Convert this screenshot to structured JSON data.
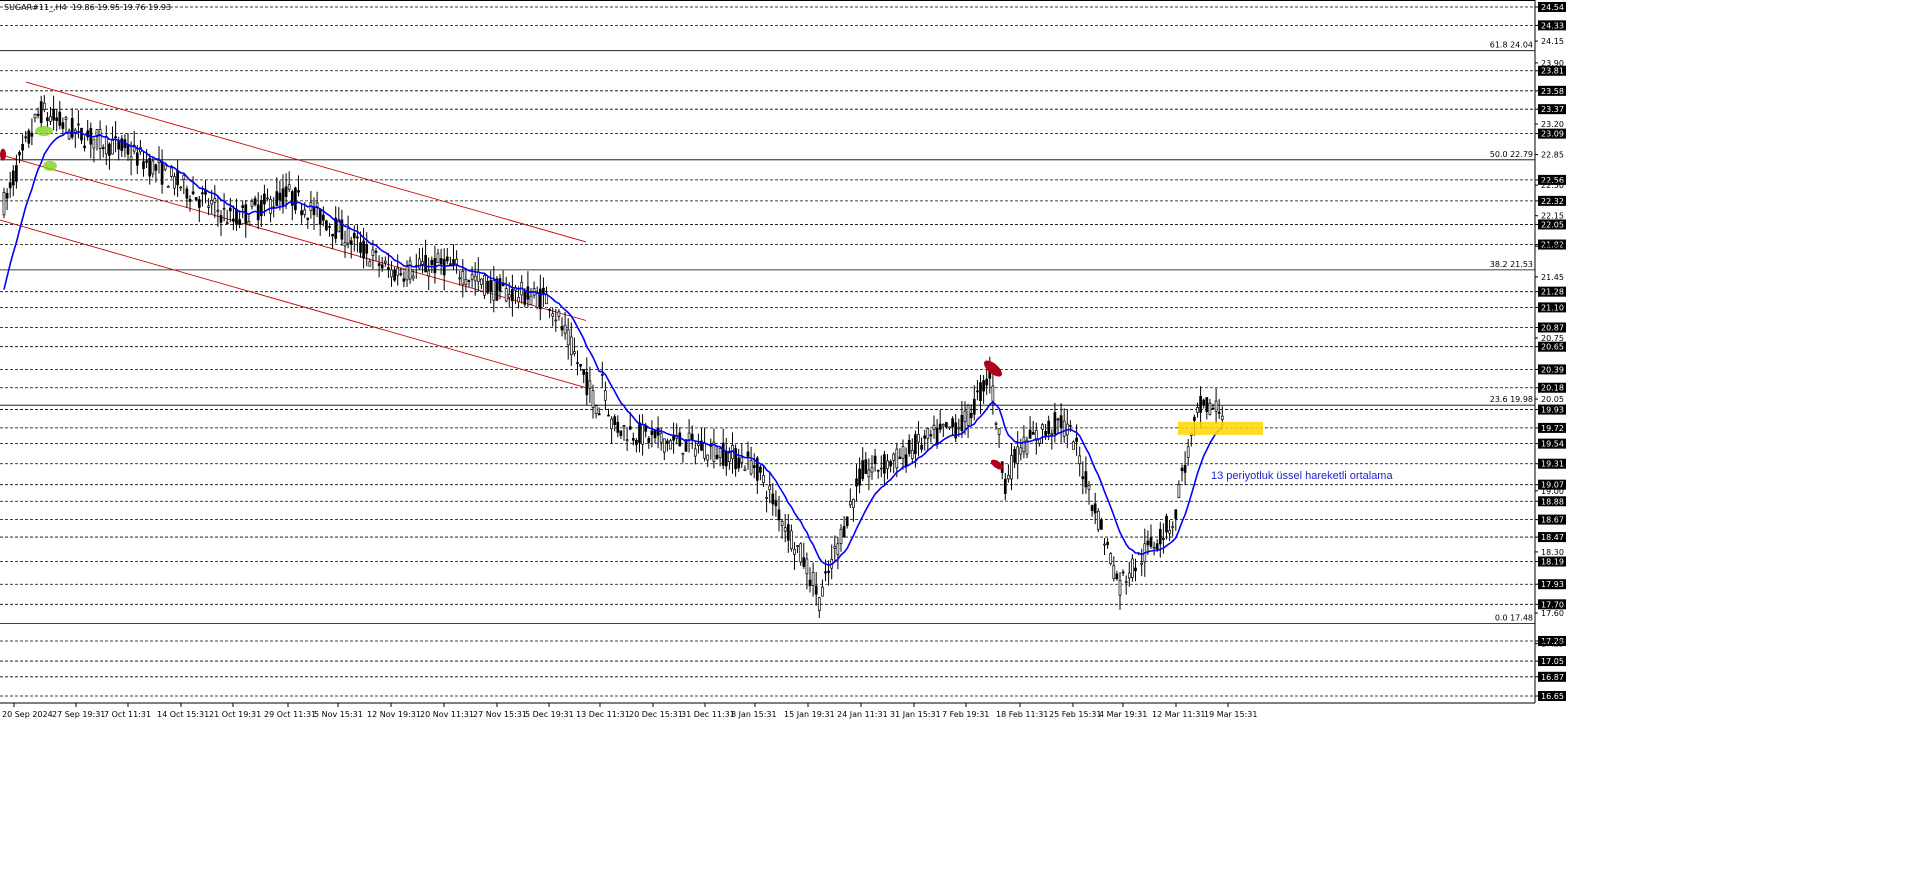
{
  "header": {
    "symbol": "SUGAR#11_,H4",
    "ohlc": "19.86 19.95 19.76 19.93"
  },
  "annotation": "13 periyotluk üssel hareketli ortalama",
  "colors": {
    "background": "#ffffff",
    "candle": "#000000",
    "ema": "#0000ff",
    "channel": "#cc0000",
    "fib": "#000000",
    "highlight": "#ffd700",
    "annotation": "#2222cc",
    "price_box": "#000000",
    "marker_green": "#7ed321",
    "marker_red": "#b0001c"
  },
  "chart_data": {
    "type": "candlestick",
    "ylim": [
      16.55,
      24.6
    ],
    "y_ticks": [
      "24.54",
      "24.33",
      "24.15",
      "23.90",
      "23.81",
      "23.58",
      "23.37",
      "23.20",
      "23.09",
      "22.85",
      "22.56",
      "22.50",
      "22.32",
      "22.15",
      "22.05",
      "21.82",
      "21.80",
      "21.45",
      "21.28",
      "21.10",
      "20.87",
      "20.75",
      "20.65",
      "20.39",
      "20.18",
      "20.05",
      "19.93",
      "19.72",
      "19.54",
      "19.31",
      "19.07",
      "19.00",
      "18.88",
      "18.67",
      "18.47",
      "18.30",
      "18.19",
      "17.93",
      "17.70",
      "17.60",
      "17.28",
      "17.25",
      "17.05",
      "16.87",
      "16.65",
      "16.55"
    ],
    "boxed_ticks": [
      "24.54",
      "24.33",
      "23.81",
      "23.58",
      "23.37",
      "23.09",
      "22.56",
      "22.32",
      "22.05",
      "21.82",
      "21.28",
      "21.10",
      "20.87",
      "20.65",
      "20.39",
      "20.18",
      "19.93",
      "19.72",
      "19.54",
      "19.31",
      "19.07",
      "18.88",
      "18.67",
      "18.47",
      "18.19",
      "17.93",
      "17.70",
      "17.28",
      "17.05",
      "16.87",
      "16.65"
    ],
    "x_tick_labels": [
      "20 Sep 2024",
      "27 Sep 19:31",
      "7 Oct 11:31",
      "14 Oct 15:31",
      "21 Oct 19:31",
      "29 Oct 11:31",
      "5 Nov 15:31",
      "12 Nov 19:31",
      "20 Nov 11:31",
      "27 Nov 15:31",
      "5 Dec 19:31",
      "13 Dec 11:31",
      "20 Dec 15:31",
      "31 Dec 11:31",
      "8 Jan 15:31",
      "15 Jan 19:31",
      "24 Jan 11:31",
      "31 Jan 15:31",
      "7 Feb 19:31",
      "18 Feb 11:31",
      "25 Feb 15:31",
      "4 Mar 19:31",
      "12 Mar 11:31",
      "19 Mar 15:31"
    ],
    "horizontal_levels": [
      24.54,
      24.33,
      23.81,
      23.58,
      23.37,
      23.09,
      22.56,
      22.32,
      22.05,
      21.82,
      21.28,
      21.1,
      20.87,
      20.65,
      20.39,
      20.18,
      19.93,
      19.72,
      19.54,
      19.31,
      19.07,
      18.88,
      18.67,
      18.47,
      18.19,
      17.93,
      17.7,
      17.28,
      17.05,
      16.87,
      16.65
    ],
    "fibonacci": [
      {
        "label": "61.8",
        "value": 24.04
      },
      {
        "label": "50.0",
        "value": 22.79
      },
      {
        "label": "38.2",
        "value": 21.53
      },
      {
        "label": "23.6",
        "value": 19.98
      },
      {
        "label": "0.0",
        "value": 17.48
      }
    ],
    "current_price": 19.93,
    "ema_period": 13,
    "price_path": [
      [
        "20 Sep 2024",
        22.6
      ],
      [
        "27 Sep 19:31",
        23.1
      ],
      [
        "7 Oct 11:31",
        22.9
      ],
      [
        "14 Oct 15:31",
        22.5
      ],
      [
        "21 Oct 19:31",
        22.1
      ],
      [
        "29 Oct 11:31",
        22.4
      ],
      [
        "5 Nov 15:31",
        22.0
      ],
      [
        "12 Nov 19:31",
        21.5
      ],
      [
        "20 Nov 11:31",
        21.6
      ],
      [
        "27 Nov 15:31",
        21.3
      ],
      [
        "5 Dec 19:31",
        21.2
      ],
      [
        "13 Dec 11:31",
        19.9
      ],
      [
        "20 Dec 15:31",
        19.6
      ],
      [
        "31 Dec 11:31",
        19.5
      ],
      [
        "8 Jan 15:31",
        19.3
      ],
      [
        "15 Jan 19:31",
        18.1
      ],
      [
        "24 Jan 11:31",
        19.2
      ],
      [
        "31 Jan 15:31",
        19.5
      ],
      [
        "7 Feb 19:31",
        19.8
      ],
      [
        "18 Feb 11:31",
        19.5
      ],
      [
        "25 Feb 15:31",
        19.6
      ],
      [
        "4 Mar 19:31",
        18.0
      ],
      [
        "12 Mar 11:31",
        18.7
      ],
      [
        "19 Mar 15:31",
        19.9
      ]
    ]
  }
}
